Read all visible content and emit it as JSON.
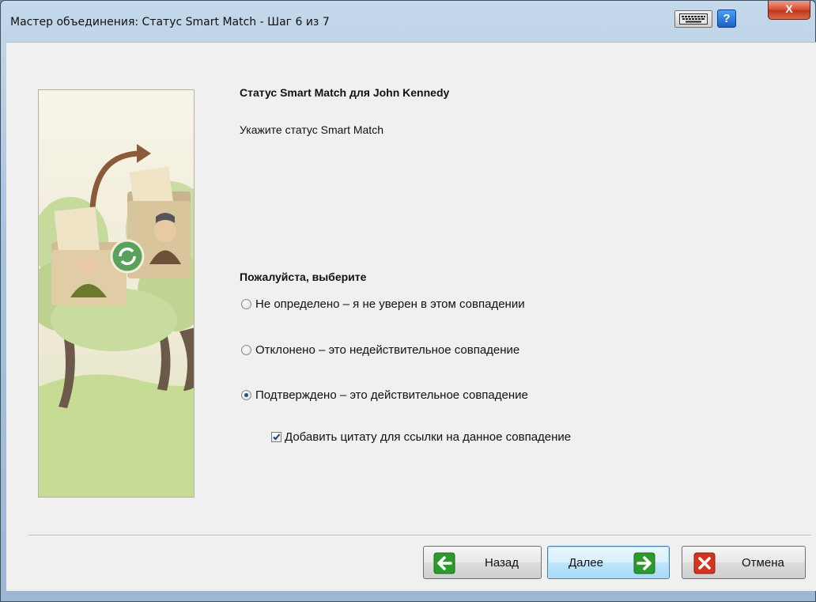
{
  "window": {
    "title": "Мастер объединения: Статус Smart Match - Шаг 6 из 7",
    "help_label": "?",
    "close_label": "X"
  },
  "main": {
    "heading": "Статус Smart Match для John Kennedy",
    "subtext": "Укажите статус Smart Match",
    "choose_label": "Пожалуйста, выберите",
    "options": [
      {
        "label": "Не определено – я не уверен в этом совпадении",
        "checked": false
      },
      {
        "label": "Отклонено – это недействительное совпадение",
        "checked": false
      },
      {
        "label": "Подтверждено – это действительное совпадение",
        "checked": true
      }
    ],
    "add_citation": {
      "label": "Добавить цитату для ссылки на данное совпадение",
      "checked": true
    }
  },
  "buttons": {
    "back": "Назад",
    "next": "Далее",
    "cancel": "Отмена"
  },
  "colors": {
    "arrow_green": "#2e9a2e",
    "cancel_red": "#d4331e",
    "title_bar": "#aac3dc"
  },
  "icons": {
    "keyboard": "keyboard-icon",
    "help": "help-icon",
    "close": "close-icon",
    "back": "arrow-left-icon",
    "next": "arrow-right-icon",
    "cancel": "x-icon"
  }
}
